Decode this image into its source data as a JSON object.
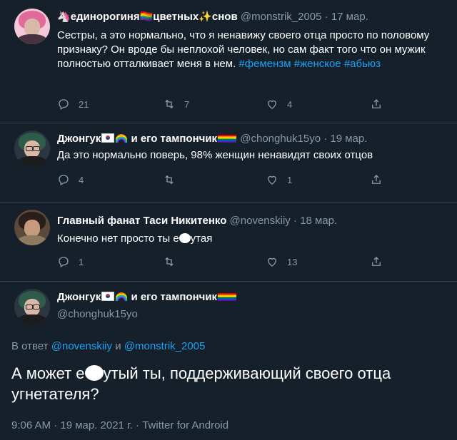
{
  "tweets": [
    {
      "name": "единорогиня🏳️‍🌈цветных✨снов",
      "handle": "@monstrik_2005",
      "date": "· 17 мар.",
      "text": "Сестры, а это нормально, что я ненавижу своего отца просто по половому признаку? Он вроде бы неплохой человек, но сам факт того что он мужик полностью отталкивает меня в нем.",
      "hashtags": [
        "#фемензм",
        "#женское",
        "#абьюз"
      ],
      "replies": "21",
      "retweets": "7",
      "likes": "4"
    },
    {
      "name": "Джонгук🇰🇷🌈 и его тампончик🏳️‍🌈",
      "handle": "@chonghuk15yo",
      "date": "· 19 мар.",
      "text": "Да это нормально поверь, 98% женщин ненавидят своих отцов",
      "replies": "4",
      "retweets": "",
      "likes": "1"
    },
    {
      "name": "Главный фанат Таси Никитенко",
      "handle": "@novenskiiy",
      "date": "· 18 мар.",
      "text_before": "Конечно нет просто ты е",
      "text_after": "утая",
      "replies": "1",
      "retweets": "",
      "likes": "13"
    }
  ],
  "main": {
    "name": "Джонгук🇰🇷🌈 и его тампончик🏳️‍🌈",
    "handle": "@chonghuk15yo",
    "reply_prefix": "В ответ",
    "reply_to_1": "@novenskiiy",
    "reply_and": "и",
    "reply_to_2": "@monstrik_2005",
    "text_before": "А может е",
    "text_after": "утый ты, поддерживающий своего отца угнетателя?",
    "meta": "9:06 AM · 19 мар. 2021 г. · Twitter for Android"
  },
  "colors": {
    "background": "#15202b",
    "muted": "#8899a6",
    "link": "#1da1f2",
    "divider": "#38444d"
  },
  "icons": [
    "reply-icon",
    "retweet-icon",
    "like-icon",
    "share-icon"
  ]
}
